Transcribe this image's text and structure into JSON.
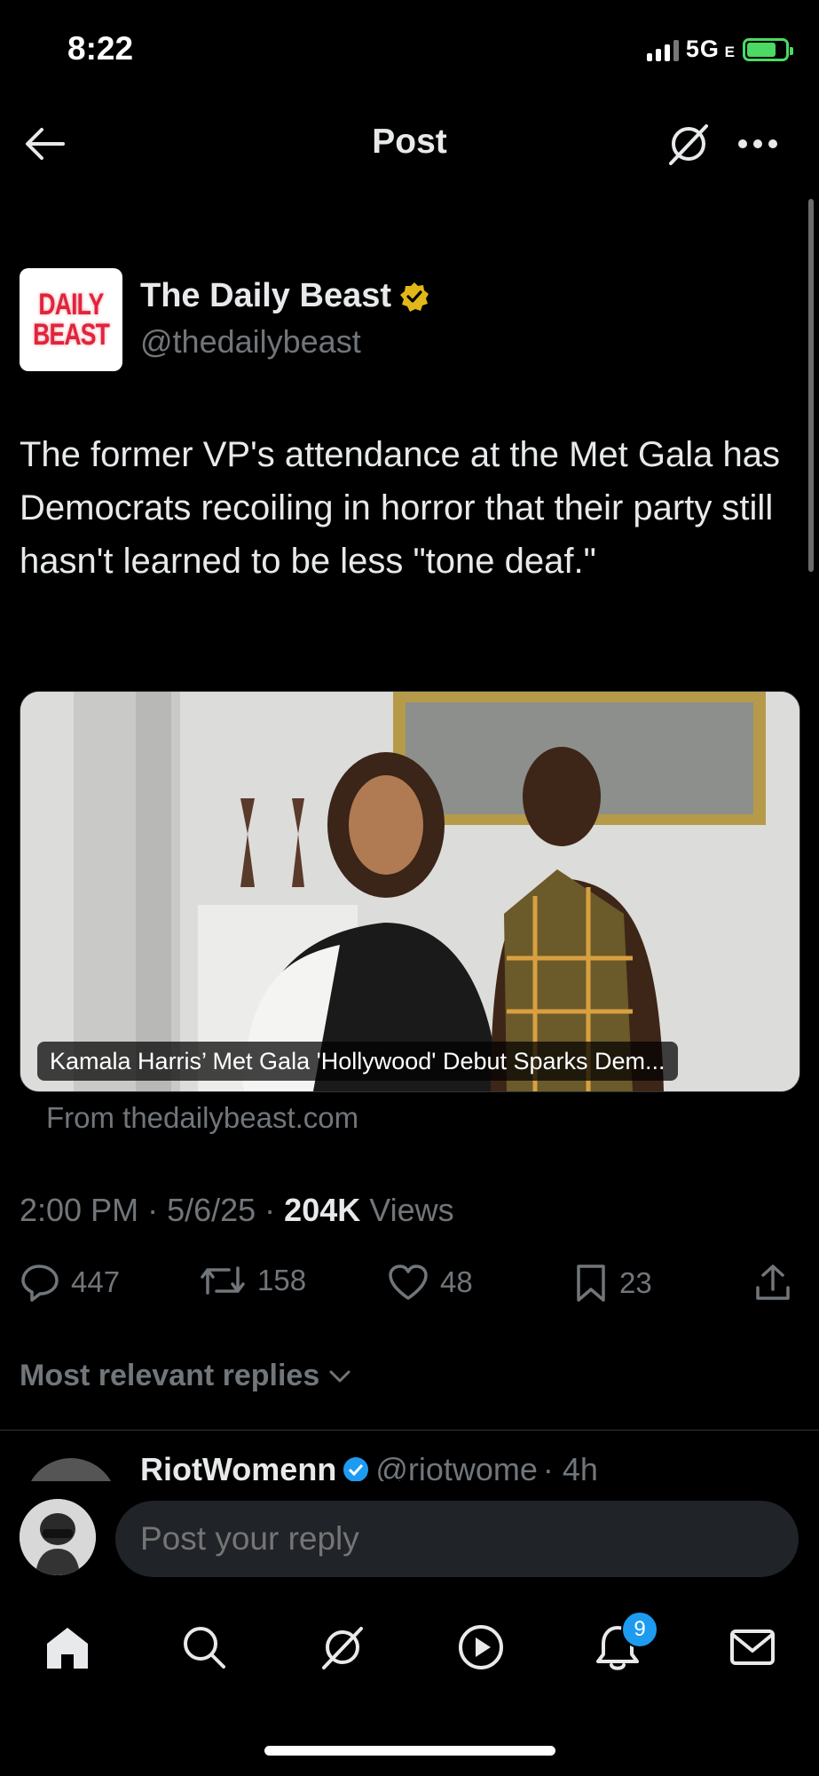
{
  "status_bar": {
    "time": "8:22",
    "network": "5G",
    "network_suffix": "E",
    "battery_level": 0.8
  },
  "header": {
    "title": "Post"
  },
  "post": {
    "author_name": "The Daily Beast",
    "author_handle": "@thedailybeast",
    "logo_lines": [
      "DAILY",
      "BEAST"
    ],
    "text": "The former VP's attendance at the Met Gala has Democrats recoiling in horror that their party still hasn't learned to be less \"tone deaf.\"",
    "card_caption": "Kamala Harris’ Met Gala 'Hollywood' Debut Sparks Dem...",
    "card_source": "From thedailybeast.com",
    "time": "2:00 PM",
    "date": "5/6/25",
    "views_count": "204K",
    "views_label": "Views",
    "replies": "447",
    "reposts": "158",
    "likes": "48",
    "bookmarks": "23"
  },
  "replies_section": {
    "sort_label": "Most relevant replies",
    "first_reply_name": "RiotWomenn",
    "first_reply_handle": "@riotwome",
    "first_reply_time": "· 4h"
  },
  "composer": {
    "placeholder": "Post your reply"
  },
  "tabbar": {
    "notifications_badge": "9"
  },
  "colors": {
    "accent": "#1d9bf0",
    "verified_gold": "#e2b719",
    "background": "#000000",
    "muted": "#71767b"
  }
}
